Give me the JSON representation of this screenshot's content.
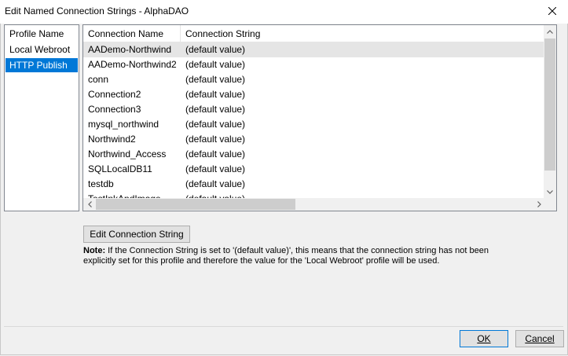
{
  "window": {
    "title": "Edit Named Connection Strings - AlphaDAO"
  },
  "profiles": {
    "header": "Profile Name",
    "items": [
      {
        "label": "Local Webroot",
        "selected": false
      },
      {
        "label": "HTTP Publish",
        "selected": true
      }
    ]
  },
  "grid": {
    "columns": [
      "Connection Name",
      "Connection String"
    ],
    "rows": [
      {
        "name": "AADemo-Northwind",
        "value": "(default value)",
        "selected": true
      },
      {
        "name": "AADemo-Northwind2",
        "value": "(default value)",
        "selected": false
      },
      {
        "name": "conn",
        "value": "(default value)",
        "selected": false
      },
      {
        "name": "Connection2",
        "value": "(default value)",
        "selected": false
      },
      {
        "name": "Connection3",
        "value": "(default value)",
        "selected": false
      },
      {
        "name": "mysql_northwind",
        "value": "(default value)",
        "selected": false
      },
      {
        "name": "Northwind2",
        "value": "(default value)",
        "selected": false
      },
      {
        "name": "Northwind_Access",
        "value": "(default value)",
        "selected": false
      },
      {
        "name": "SQLLocalDB11",
        "value": "(default value)",
        "selected": false
      },
      {
        "name": "testdb",
        "value": "(default value)",
        "selected": false
      },
      {
        "name": "TestInkAndImage",
        "value": "(default value)",
        "selected": false
      }
    ]
  },
  "buttons": {
    "edit": "Edit Connection String",
    "ok": "OK",
    "cancel": "Cancel"
  },
  "note": {
    "label": "Note:",
    "text": " If the Connection String is set to '(default value)', this means that the connection string has not been explicitly set for this profile and therefore the value for the 'Local Webroot' profile will be used."
  },
  "colors": {
    "selection": "#0078d7",
    "row_highlight": "#e5e5e5"
  }
}
